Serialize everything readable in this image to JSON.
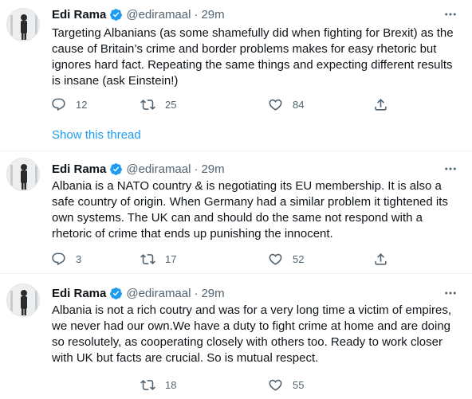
{
  "tweets": [
    {
      "name": "Edi Rama",
      "handle": "@ediramaal",
      "separator": "·",
      "time": "29m",
      "text": "Targeting Albanians (as some shamefully did when fighting for Brexit) as the cause of Britain’s crime and border problems makes for easy rhetoric but ignores hard fact.  Repeating the same things and expecting different results is insane (ask Einstein!)",
      "replies": "12",
      "retweets": "25",
      "likes": "84",
      "show_thread": "Show this thread"
    },
    {
      "name": "Edi Rama",
      "handle": "@ediramaal",
      "separator": "·",
      "time": "29m",
      "text": "Albania is a NATO country & is negotiating its EU membership. It is also a safe country of origin. When Germany had a similar problem it tightened its own systems. The UK can and should do the same not respond with a rhetoric of crime that ends up punishing the innocent.",
      "replies": "3",
      "retweets": "17",
      "likes": "52"
    },
    {
      "name": "Edi Rama",
      "handle": "@ediramaal",
      "separator": "·",
      "time": "29m",
      "text": "Albania is not a rich coutry and was for a very long time a victim of empires, we never had our own.We have a duty to fight crime at home and are doing so resolutely, as cooperating closely with others too. Ready to work closer with UK but facts are crucial. So is mutual respect.",
      "retweets": "18",
      "likes": "55"
    }
  ],
  "icons": {
    "verified": "verified-badge-icon",
    "more": "more-options-icon",
    "reply": "reply-icon",
    "retweet": "retweet-icon",
    "like": "like-icon",
    "share": "share-icon"
  },
  "colors": {
    "accent": "#1d9bf0",
    "text": "#0f1419",
    "secondary": "#536471",
    "divider": "#eff3f4"
  }
}
